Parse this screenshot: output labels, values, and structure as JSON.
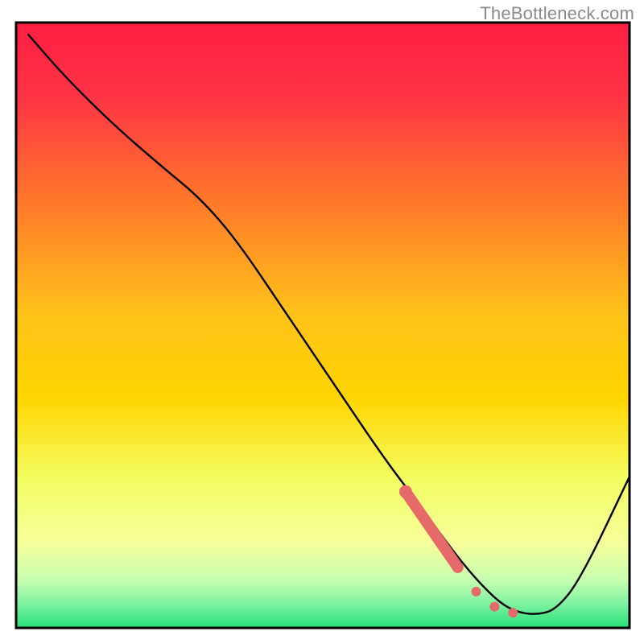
{
  "watermark": "TheBottleneck.com",
  "colors": {
    "top": "#ff1f41",
    "mid": "#ffd500",
    "low": "#f6ff9a",
    "green": "#26e07a",
    "border": "#000000",
    "curve": "#000000",
    "marker": "#e66a6a"
  },
  "chart_data": {
    "type": "line",
    "title": "",
    "xlabel": "",
    "ylabel": "",
    "xlim": [
      0,
      100
    ],
    "ylim": [
      0,
      100
    ],
    "grid": false,
    "series": [
      {
        "name": "bottleneck-curve",
        "x": [
          2,
          8,
          16,
          24,
          30,
          36,
          44,
          52,
          60,
          66,
          71,
          75,
          79,
          82,
          85,
          88,
          92,
          100
        ],
        "y": [
          98,
          91,
          83,
          76,
          71,
          64,
          52,
          40,
          28,
          20,
          13,
          8,
          4,
          2.5,
          2.2,
          3,
          8,
          25
        ]
      }
    ],
    "markers": {
      "name": "highlighted-range",
      "points": [
        {
          "x": 63.5,
          "y": 22.5
        },
        {
          "x": 72.0,
          "y": 10.0
        },
        {
          "x": 75.0,
          "y": 6.0
        },
        {
          "x": 78.0,
          "y": 3.5
        },
        {
          "x": 81.0,
          "y": 2.5
        }
      ],
      "thick_segment": {
        "x1": 63.5,
        "y1": 22.5,
        "x2": 72.0,
        "y2": 10.0
      }
    }
  }
}
